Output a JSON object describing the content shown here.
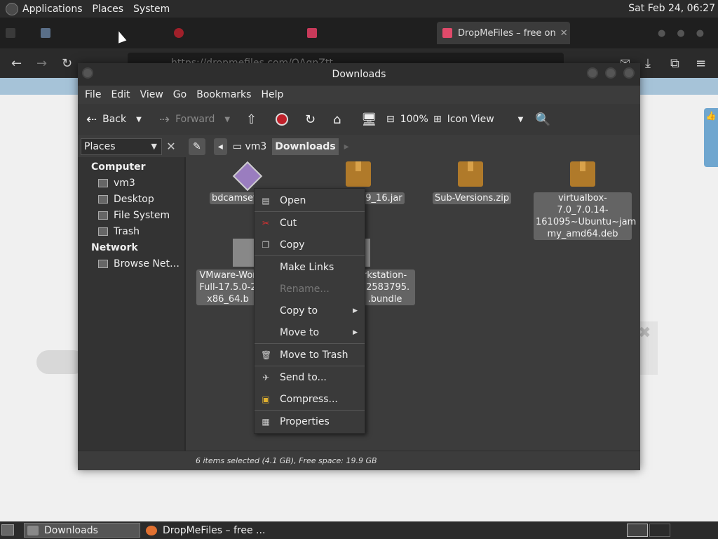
{
  "top_panel": {
    "menus": [
      "Applications",
      "Places",
      "System"
    ],
    "clock": "Sat Feb 24, 06:27"
  },
  "browser": {
    "tabs": [
      {
        "label": "",
        "active": false
      },
      {
        "label": "",
        "active": false
      },
      {
        "label": "",
        "active": false
      },
      {
        "label": "DropMeFiles – free on",
        "active": true
      }
    ],
    "url": "https://dropmefiles.com/QAgnZtt"
  },
  "nautilus": {
    "title": "Downloads",
    "menu": [
      "File",
      "Edit",
      "View",
      "Go",
      "Bookmarks",
      "Help"
    ],
    "toolbar": {
      "back": "Back",
      "forward": "Forward",
      "zoom": "100%",
      "view_mode": "Icon View"
    },
    "places_combo": "Places",
    "breadcrumbs": [
      "vm3",
      "Downloads"
    ],
    "sidebar": {
      "computer_heading": "Computer",
      "computer_items": [
        "vm3",
        "Desktop",
        "File System",
        "Trash"
      ],
      "network_heading": "Network",
      "network_items": [
        "Browse Net…"
      ]
    },
    "files": {
      "f1": "bdcamset",
      "f2": "09_16.jar",
      "f3": "Sub-Versions.zip",
      "f4_l1": "virtualbox-7.0_7.0.14-",
      "f4_l2": "161095~Ubuntu~jam",
      "f4_l3": "my_amd64.deb",
      "f5_l1": "VMware-Wor",
      "f5_l2": "Full-17.5.0-2",
      "f5_l3": "x86_64.b",
      "f6_l1": "rkstation-",
      "f6_l2": "22583795.",
      "f6_l3": ".bundle"
    },
    "status": "6 items selected (4.1 GB), Free space: 19.9 GB"
  },
  "context_menu": {
    "open": "Open",
    "cut": "Cut",
    "copy": "Copy",
    "make_links": "Make Links",
    "rename": "Rename...",
    "copy_to": "Copy to",
    "move_to": "Move to",
    "move_to_trash": "Move to Trash",
    "send_to": "Send to...",
    "compress": "Compress...",
    "properties": "Properties"
  },
  "taskbar": {
    "items": [
      "Downloads",
      "DropMeFiles – free ..."
    ]
  },
  "colors": {
    "panel": "#2b2b2b",
    "window": "#3c3c3c",
    "selection": "#646464",
    "record_red": "#c0202a",
    "folder_brown": "#b07a2a"
  }
}
